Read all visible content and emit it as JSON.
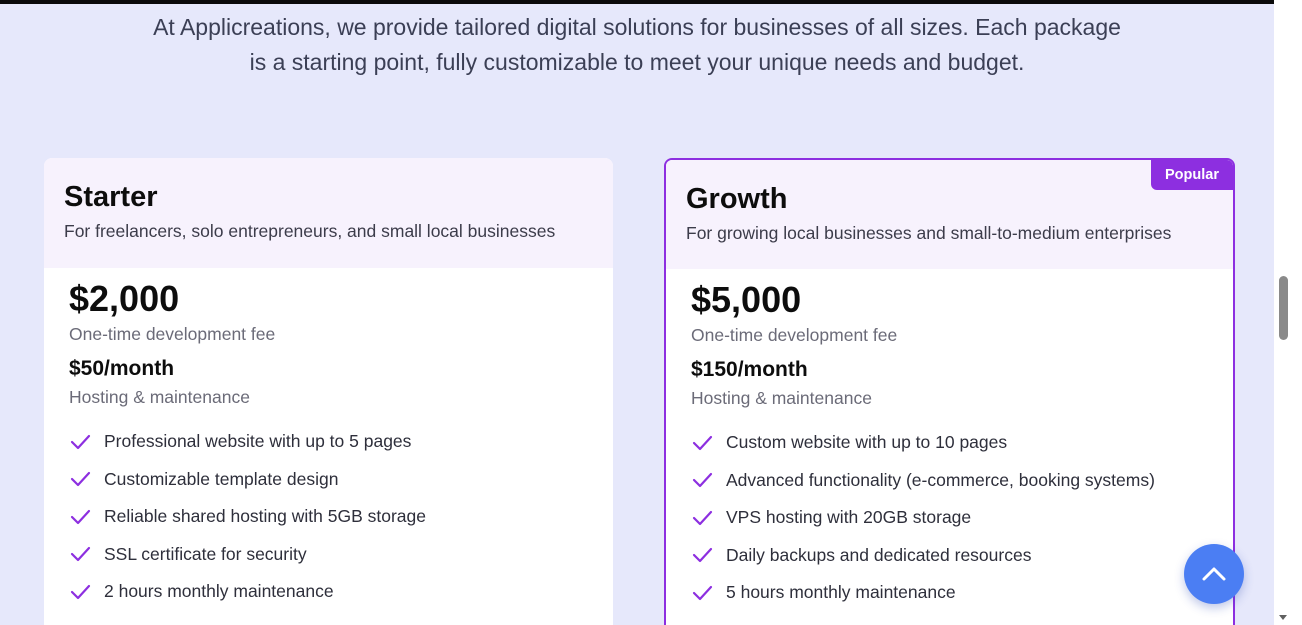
{
  "intro": {
    "line1": "At Applicreations, we provide tailored digital solutions for businesses of all sizes. Each package",
    "line2": "is a starting point, fully customizable to meet your unique needs and budget."
  },
  "plans": [
    {
      "title": "Starter",
      "subtitle": "For freelancers, solo entrepreneurs, and small local businesses",
      "price": "$2,000",
      "price_note": "One-time development fee",
      "monthly": "$50/month",
      "monthly_note": "Hosting & maintenance",
      "features": [
        "Professional website with up to 5 pages",
        "Customizable template design",
        "Reliable shared hosting with 5GB storage",
        "SSL certificate for security",
        "2 hours monthly maintenance"
      ]
    },
    {
      "title": "Growth",
      "subtitle": "For growing local businesses and small-to-medium enterprises",
      "badge": "Popular",
      "price": "$5,000",
      "price_note": "One-time development fee",
      "monthly": "$150/month",
      "monthly_note": "Hosting & maintenance",
      "features": [
        "Custom website with up to 10 pages",
        "Advanced functionality (e-commerce, booking systems)",
        "VPS hosting with 20GB storage",
        "Daily backups and dedicated resources",
        "5 hours monthly maintenance"
      ]
    }
  ],
  "colors": {
    "accent": "#8d2fe0",
    "background": "#e6e8fb",
    "fab": "#4b7ef3"
  },
  "icons": {
    "check": "check-icon",
    "scroll_top": "chevron-up-icon"
  }
}
